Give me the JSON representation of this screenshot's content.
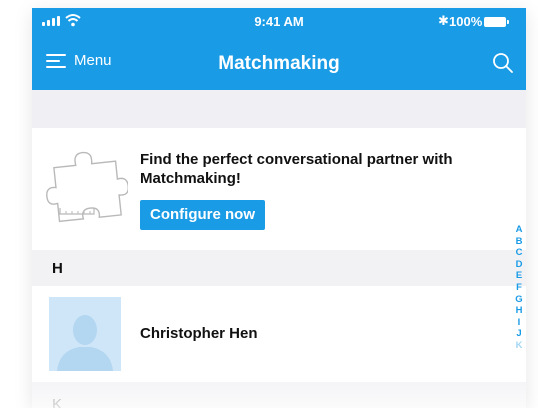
{
  "status_bar": {
    "time": "9:41 AM",
    "battery_percent": "100%",
    "signal_icon": "signal-bars-icon",
    "wifi_icon": "wifi-icon",
    "bluetooth_icon": "bluetooth-icon",
    "battery_icon": "battery-icon"
  },
  "nav": {
    "menu_label": "Menu",
    "title": "Matchmaking",
    "menu_icon": "hamburger-icon",
    "search_icon": "search-icon"
  },
  "promo": {
    "icon": "puzzle-piece-icon",
    "text": "Find the perfect conversational partner with Matchmaking!",
    "button_label": "Configure now"
  },
  "sections": [
    {
      "letter": "H",
      "contacts": [
        {
          "name": "Christopher Hen",
          "avatar_icon": "person-placeholder-icon"
        }
      ]
    },
    {
      "letter": "K",
      "contacts": []
    }
  ],
  "index_letters": [
    "A",
    "B",
    "C",
    "D",
    "E",
    "F",
    "G",
    "H",
    "I",
    "J",
    "K"
  ],
  "colors": {
    "accent": "#1a9be6",
    "avatar_bg": "#cfe6f8",
    "section_bg": "#f2f2f5"
  }
}
